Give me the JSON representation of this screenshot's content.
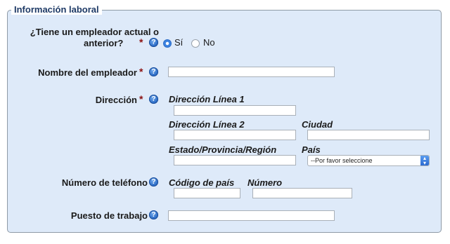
{
  "section": {
    "legend": "Información laboral"
  },
  "employer_question": {
    "label_line1": "¿Tiene un empleador actual o",
    "label_line2": "anterior?",
    "options": [
      {
        "label": "Sí",
        "selected": true
      },
      {
        "label": "No",
        "selected": false
      }
    ]
  },
  "employer_name": {
    "label": "Nombre del empleador",
    "value": ""
  },
  "address": {
    "label": "Dirección",
    "line1_label": "Dirección Línea 1",
    "line2_label": "Dirección Línea 2",
    "city_label": "Ciudad",
    "state_label": "Estado/Provincia/Región",
    "country_label": "País",
    "country_selected": "--Por favor seleccione"
  },
  "phone": {
    "label": "Número de teléfono",
    "country_code_label": "Código de país",
    "number_label": "Número"
  },
  "job_title": {
    "label": "Puesto de trabajo"
  },
  "required_mark": "*",
  "help_glyph": "?",
  "colors": {
    "panel": "#deeaf9",
    "required": "#8b1010",
    "help": "#2f6fc8",
    "legend": "#1e3a66"
  }
}
